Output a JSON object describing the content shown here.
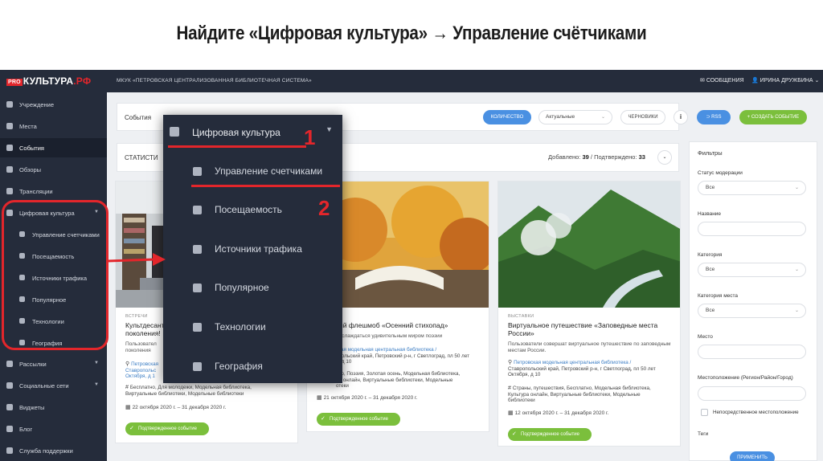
{
  "headline": "Найдите «Цифровая культура» → Управление счётчиками",
  "topbar": {
    "logo_pro": "PRO",
    "logo_main": "КУЛЬТУРА",
    "logo_rf": ".РФ",
    "org": "МКУК «ПЕТРОВСКАЯ ЦЕНТРАЛИЗОВАННАЯ БИБЛИОТЕЧНАЯ СИСТЕМА»",
    "messages": "СООБЩЕНИЯ",
    "user": "ИРИНА ДРУЖБИНА"
  },
  "sidebar": {
    "items": [
      {
        "label": "Учреждение",
        "icon": "building-icon"
      },
      {
        "label": "Места",
        "icon": "places-icon"
      },
      {
        "label": "События",
        "icon": "calendar-icon"
      },
      {
        "label": "Обзоры",
        "icon": "reviews-icon"
      },
      {
        "label": "Трансляции",
        "icon": "broadcast-icon"
      },
      {
        "label": "Цифровая культура",
        "icon": "chart-icon"
      },
      {
        "label": "Управление счетчиками",
        "icon": "chart-icon"
      },
      {
        "label": "Посещаемость",
        "icon": "chart-icon"
      },
      {
        "label": "Источники трафика",
        "icon": "chart-icon"
      },
      {
        "label": "Популярное",
        "icon": "chart-icon"
      },
      {
        "label": "Технологии",
        "icon": "chart-icon"
      },
      {
        "label": "География",
        "icon": "chart-icon"
      },
      {
        "label": "Рассылки",
        "icon": "mail-icon"
      },
      {
        "label": "Социальные сети",
        "icon": "vk-icon"
      },
      {
        "label": "Виджеты",
        "icon": "widget-icon"
      },
      {
        "label": "Блог",
        "icon": "blog-icon"
      },
      {
        "label": "Служба поддержки",
        "icon": "support-icon"
      }
    ]
  },
  "events": {
    "title": "События",
    "count_button": "КОЛИЧЕСТВО",
    "status_select": "Актуальные",
    "drafts": "ЧЕРНОВИКИ",
    "info": "i",
    "rss": "RSS",
    "create": "СОЗДАТЬ СОБЫТИЕ"
  },
  "stats": {
    "title": "СТАТИСТИ",
    "added_label": "Добавлено:",
    "added": "39",
    "separator": "/",
    "confirmed_label": "Подтверждено:",
    "confirmed": "33"
  },
  "cards": [
    {
      "category": "ВСТРЕЧИ",
      "title": "Культдесант\nпоколения!",
      "desc": "Пользовател\nпоколения",
      "loc": "Петровская\nСтавропольс\nОктября, д 1",
      "tags": "Бесплатно, Для молодежи, Модельная библиотека,\nВиртуальные библиотеки, Модельные библиотеки",
      "date": "22 октября 2020 г. – 31 декабря 2020 г.",
      "badge": "Подтвержденное событие"
    },
    {
      "category": "",
      "title": "ский флешмоб «Осенний стихопад»",
      "desc": "наслаждаться удивительным миром поэзии",
      "loc_link": "ская модельная центральная библиотека /",
      "loc": "опольский край, Петровский р-н, г Светлоград, пл 50 лет\nя, д 10",
      "tags": "тно, Поэзия, Золотая осень, Модельная библиотека,\nра онлайн, Виртуальные библиотеки, Модельные\nотеки",
      "date": "21 октября 2020 г. – 31 декабря 2020 г.",
      "badge": "Подтвержденное событие"
    },
    {
      "category": "ВЫСТАВКИ",
      "title": "Виртуальное путешествие «Заповедные места\nРоссии»",
      "desc": "Пользователи совершат виртуальное путешествие по заповедным\nместам России.",
      "loc_link": "Петровская модельная центральная библиотека /",
      "loc": "Ставропольский край, Петровский р-н, г Светлоград, пл 50 лет\nОктября, д 10",
      "tags": "Страны, путешествия, Бесплатно, Модельная библиотека,\nКультура онлайн, Виртуальные библиотеки, Модельные\nбиблиотеки",
      "date": "12 октября 2020 г. – 31 декабря 2020 г.",
      "badge": "Подтвержденное событие"
    }
  ],
  "filters": {
    "title": "Фильтры",
    "moderation_label": "Статус модерации",
    "moderation_value": "Все",
    "name_label": "Название",
    "category_label": "Категория",
    "category_value": "Все",
    "place_category_label": "Категория места",
    "place_category_value": "Все",
    "place_label": "Место",
    "location_label": "Местоположение (Регион/Район/Город)",
    "direct_location": "Непосредственное местоположение",
    "tags_label": "Теги",
    "apply": "ПРИМЕНИТЬ"
  },
  "overlay": {
    "header": "Цифровая культура",
    "items": [
      "Управление счетчиками",
      "Посещаемость",
      "Источники трафика",
      "Популярное",
      "Технологии",
      "География"
    ]
  },
  "annotations": {
    "step1": "1",
    "step2": "2"
  },
  "colors": {
    "accent": "#e3262b",
    "sidebar": "#252c3b",
    "blue": "#4a90e2",
    "green": "#7bbf3c"
  }
}
